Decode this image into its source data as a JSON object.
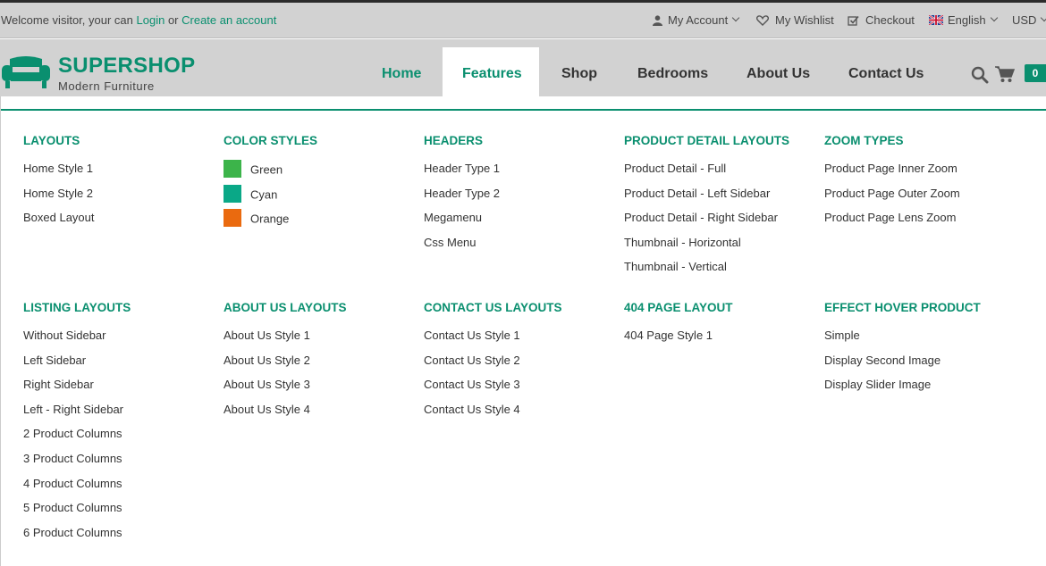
{
  "topbar": {
    "welcome_prefix": "Welcome visitor, your can",
    "login": "Login",
    "or": "or",
    "create_account": "Create an account",
    "my_account": "My Account",
    "wishlist": "My Wishlist",
    "checkout": "Checkout",
    "language": "English",
    "currency": "USD"
  },
  "brand": {
    "name": "SUPERSHOP",
    "tagline": "Modern Furniture"
  },
  "nav": {
    "home": "Home",
    "features": "Features",
    "shop": "Shop",
    "bedrooms": "Bedrooms",
    "about": "About Us",
    "contact": "Contact Us"
  },
  "cart": {
    "count": "0"
  },
  "colors": {
    "accent": "#0a8f6f",
    "green": "#3cb44a",
    "cyan": "#0aa887",
    "orange": "#ea6a0f"
  },
  "menu": {
    "row1": [
      {
        "title": "LAYOUTS",
        "items": [
          "Home Style 1",
          "Home Style 2",
          "Boxed Layout"
        ]
      },
      {
        "title": "COLOR STYLES",
        "items": [
          "Green",
          "Cyan",
          "Orange"
        ]
      },
      {
        "title": "HEADERS",
        "items": [
          "Header Type 1",
          "Header Type 2",
          "Megamenu",
          "Css Menu"
        ]
      },
      {
        "title": "PRODUCT DETAIL LAYOUTS",
        "items": [
          "Product Detail - Full",
          "Product Detail - Left Sidebar",
          "Product Detail - Right Sidebar",
          "Thumbnail - Horizontal",
          "Thumbnail - Vertical"
        ]
      },
      {
        "title": "ZOOM TYPES",
        "items": [
          "Product Page Inner Zoom",
          "Product Page Outer Zoom",
          "Product Page Lens Zoom"
        ]
      }
    ],
    "row2": [
      {
        "title": "LISTING LAYOUTS",
        "items": [
          "Without Sidebar",
          "Left Sidebar",
          "Right Sidebar",
          "Left - Right Sidebar",
          "2 Product Columns",
          "3 Product Columns",
          "4 Product Columns",
          "5 Product Columns",
          "6 Product Columns"
        ]
      },
      {
        "title": "ABOUT US LAYOUTS",
        "items": [
          "About Us Style 1",
          "About Us Style 2",
          "About Us Style 3",
          "About Us Style 4"
        ]
      },
      {
        "title": "CONTACT US LAYOUTS",
        "items": [
          "Contact Us Style 1",
          "Contact Us Style 2",
          "Contact Us Style 3",
          "Contact Us Style 4"
        ]
      },
      {
        "title": "404 PAGE LAYOUT",
        "items": [
          "404 Page Style 1"
        ]
      },
      {
        "title": "EFFECT HOVER PRODUCT",
        "items": [
          "Simple",
          "Display Second Image",
          "Display Slider Image"
        ]
      }
    ]
  }
}
